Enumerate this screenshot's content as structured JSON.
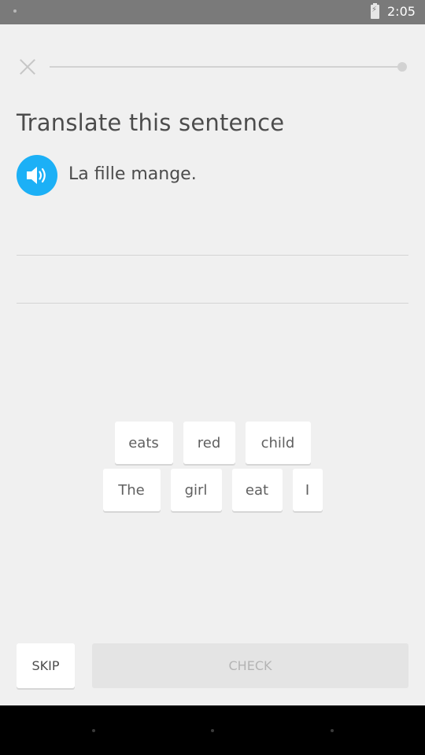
{
  "status_bar": {
    "time": "2:05"
  },
  "lesson": {
    "progress_fraction": 0.0
  },
  "title": "Translate this sentence",
  "prompt": {
    "sentence": "La fille mange."
  },
  "word_bank": {
    "row1": [
      "eats",
      "red",
      "child"
    ],
    "row2": [
      "The",
      "girl",
      "eat",
      "I"
    ]
  },
  "footer": {
    "skip_label": "SKIP",
    "check_label": "CHECK"
  },
  "colors": {
    "accent": "#1cb0f6",
    "title_text": "#4c4c4c",
    "background": "#f0f0f0"
  },
  "icons": {
    "close": "close-icon",
    "speaker": "speaker-icon",
    "battery": "battery-charging-icon"
  }
}
